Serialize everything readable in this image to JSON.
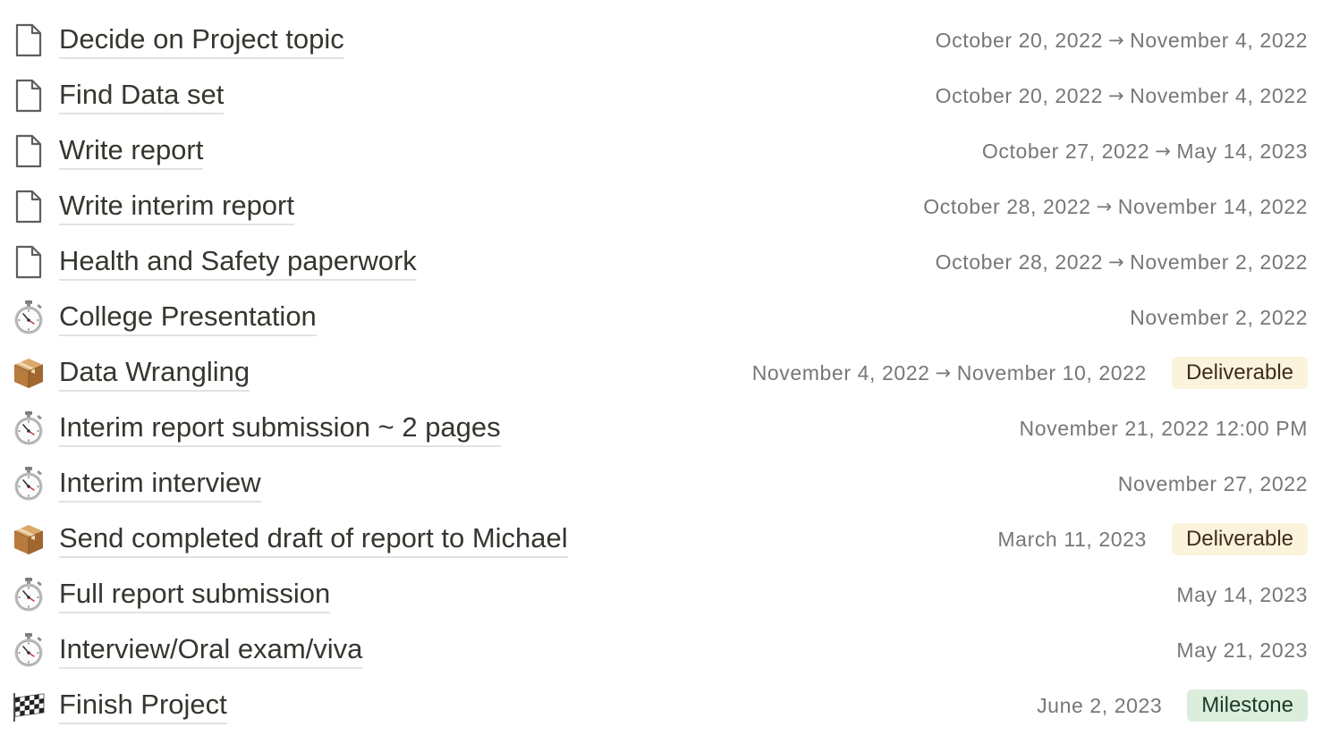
{
  "items": [
    {
      "icon": "document-icon",
      "title": "Decide on Project topic",
      "start": "October 20, 2022",
      "end": "November 4, 2022",
      "tag": null
    },
    {
      "icon": "document-icon",
      "title": "Find Data set",
      "start": "October 20, 2022",
      "end": "November 4, 2022",
      "tag": null
    },
    {
      "icon": "document-icon",
      "title": "Write report",
      "start": "October 27, 2022",
      "end": "May 14, 2023",
      "tag": null
    },
    {
      "icon": "document-icon",
      "title": "Write interim report",
      "start": "October 28, 2022",
      "end": "November 14, 2022",
      "tag": null
    },
    {
      "icon": "document-icon",
      "title": "Health and Safety paperwork",
      "start": "October 28, 2022",
      "end": "November 2, 2022",
      "tag": null
    },
    {
      "icon": "stopwatch-icon",
      "title": "College Presentation",
      "start": "November 2, 2022",
      "end": null,
      "tag": null
    },
    {
      "icon": "package-icon",
      "title": "Data Wrangling",
      "start": "November 4, 2022",
      "end": "November 10, 2022",
      "tag": "Deliverable",
      "tag_kind": "deliverable"
    },
    {
      "icon": "stopwatch-icon",
      "title": "Interim report submission ~ 2 pages",
      "start": "November 21, 2022 12:00 PM",
      "end": null,
      "tag": null
    },
    {
      "icon": "stopwatch-icon",
      "title": "Interim interview",
      "start": "November 27, 2022",
      "end": null,
      "tag": null
    },
    {
      "icon": "package-icon",
      "title": "Send completed draft of report to Michael",
      "start": "March 11, 2023",
      "end": null,
      "tag": "Deliverable",
      "tag_kind": "deliverable"
    },
    {
      "icon": "stopwatch-icon",
      "title": "Full report submission",
      "start": "May 14, 2023",
      "end": null,
      "tag": null
    },
    {
      "icon": "stopwatch-icon",
      "title": "Interview/Oral exam/viva",
      "start": "May 21, 2023",
      "end": null,
      "tag": null
    },
    {
      "icon": "checkered-flag-icon",
      "title": "Finish Project",
      "start": "June 2, 2023",
      "end": null,
      "tag": "Milestone",
      "tag_kind": "milestone"
    }
  ],
  "colors": {
    "deliverable_bg": "#fbf3db",
    "milestone_bg": "#dbeddb",
    "title_text": "#37352f",
    "date_text": "#787774"
  }
}
